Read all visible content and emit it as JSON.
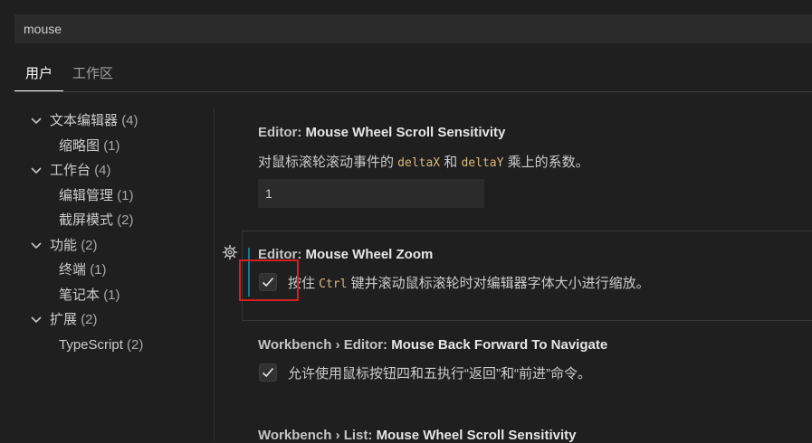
{
  "search": {
    "value": "mouse"
  },
  "tabs": [
    {
      "label": "用户"
    },
    {
      "label": "工作区"
    }
  ],
  "toc": [
    {
      "label": "文本编辑器",
      "count": "(4)"
    },
    {
      "label": "缩略图",
      "count": "(1)"
    },
    {
      "label": "工作台",
      "count": "(4)"
    },
    {
      "label": "编辑管理",
      "count": "(1)"
    },
    {
      "label": "截屏模式",
      "count": "(2)"
    },
    {
      "label": "功能",
      "count": "(2)"
    },
    {
      "label": "终端",
      "count": "(1)"
    },
    {
      "label": "笔记本",
      "count": "(1)"
    },
    {
      "label": "扩展",
      "count": "(2)"
    },
    {
      "label": "TypeScript",
      "count": "(2)"
    }
  ],
  "settings": {
    "scroll_sensitivity": {
      "category": "Editor: ",
      "name": "Mouse Wheel Scroll Sensitivity",
      "desc_pre": "对鼠标滚轮滚动事件的 ",
      "code1": "deltaX",
      "desc_mid": " 和 ",
      "code2": "deltaY",
      "desc_post": " 乘上的系数。",
      "value": "1"
    },
    "wheel_zoom": {
      "category": "Editor: ",
      "name": "Mouse Wheel Zoom",
      "desc_pre": "按住 ",
      "code": "Ctrl",
      "desc_post": " 键并滚动鼠标滚轮时对编辑器字体大小进行缩放。",
      "checked": true
    },
    "back_forward": {
      "category": "Workbench › Editor: ",
      "name": "Mouse Back Forward To Navigate",
      "desc": "允许使用鼠标按钮四和五执行“返回”和“前进”命令。",
      "checked": true
    },
    "list_scroll": {
      "category": "Workbench › List: ",
      "name": "Mouse Wheel Scroll Sensitivity"
    }
  }
}
